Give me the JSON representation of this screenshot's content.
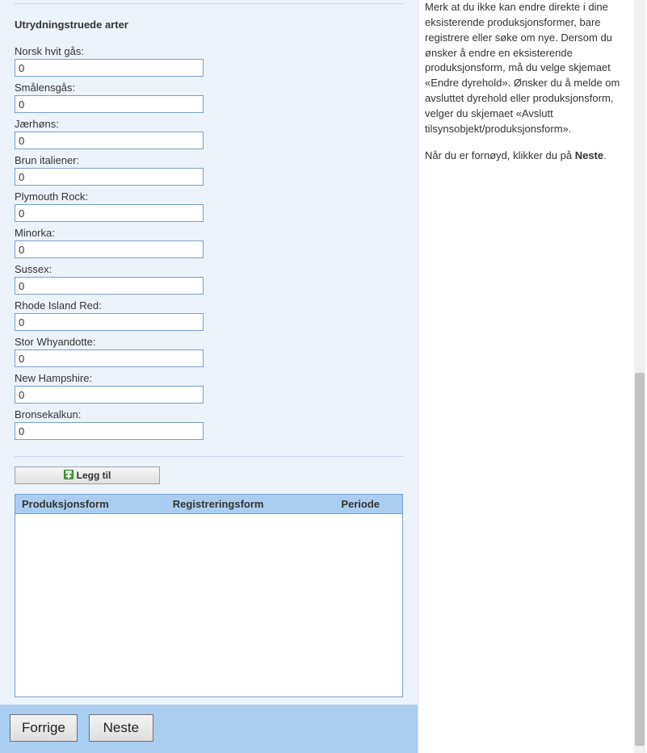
{
  "section": {
    "title": "Utrydningstruede arter"
  },
  "fields": [
    {
      "label": "Norsk hvit gås:",
      "value": "0"
    },
    {
      "label": "Smålensgås:",
      "value": "0"
    },
    {
      "label": "Jærhøns:",
      "value": "0"
    },
    {
      "label": "Brun italiener:",
      "value": "0"
    },
    {
      "label": "Plymouth Rock:",
      "value": "0"
    },
    {
      "label": "Minorka:",
      "value": "0"
    },
    {
      "label": "Sussex:",
      "value": "0"
    },
    {
      "label": "Rhode Island Red:",
      "value": "0"
    },
    {
      "label": "Stor Whyandotte:",
      "value": "0"
    },
    {
      "label": "New Hampshire:",
      "value": "0"
    },
    {
      "label": "Bronsekalkun:",
      "value": "0"
    }
  ],
  "buttons": {
    "add": "Legg til",
    "prev": "Forrige",
    "next": "Neste"
  },
  "table": {
    "columns": [
      "Produksjonsform",
      "Registreringsform",
      "Periode"
    ],
    "rows": []
  },
  "help": {
    "p1": "Merk at du ikke kan endre direkte i dine eksisterende produksjonsformer, bare registrere eller søke om nye. Dersom du ønsker å endre en eksisterende produksjonsform, må du velge skjemaet «Endre dyrehold». Ønsker du å melde om avsluttet dyrehold eller produksjonsform, velger du skjemaet «Avslutt tilsynsobjekt/produksjonsform».",
    "p2a": "Når du er fornøyd, klikker du på ",
    "p2b": "Neste",
    "p2c": "."
  }
}
